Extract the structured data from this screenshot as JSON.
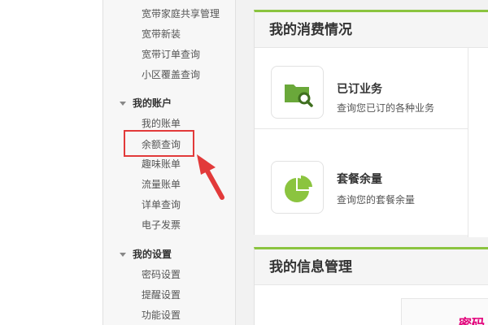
{
  "sidebar": {
    "top_items": [
      {
        "label": "宽带家庭共享管理"
      },
      {
        "label": "宽带新装"
      },
      {
        "label": "宽带订单查询"
      },
      {
        "label": "小区覆盖查询"
      }
    ],
    "account_group": {
      "title": "我的账户",
      "items": [
        {
          "label": "我的账单"
        },
        {
          "label": "余额查询"
        },
        {
          "label": "趣味账单"
        },
        {
          "label": "流量账单"
        },
        {
          "label": "详单查询"
        },
        {
          "label": "电子发票"
        }
      ]
    },
    "settings_group": {
      "title": "我的设置",
      "items": [
        {
          "label": "密码设置"
        },
        {
          "label": "提醒设置"
        },
        {
          "label": "功能设置"
        }
      ]
    }
  },
  "consumption": {
    "title": "我的消费情况",
    "cards": [
      {
        "title": "已订业务",
        "desc": "查询您已订的各种业务",
        "icon": "folder-search-icon"
      },
      {
        "title": "套餐余量",
        "desc": "查询您的套餐余量",
        "icon": "pie-chart-icon"
      }
    ]
  },
  "info_management": {
    "title": "我的信息管理",
    "partial_text": "密码"
  },
  "colors": {
    "accent_green": "#8bc43f",
    "highlight_red": "#e23a3a",
    "pink": "#e2007a"
  }
}
